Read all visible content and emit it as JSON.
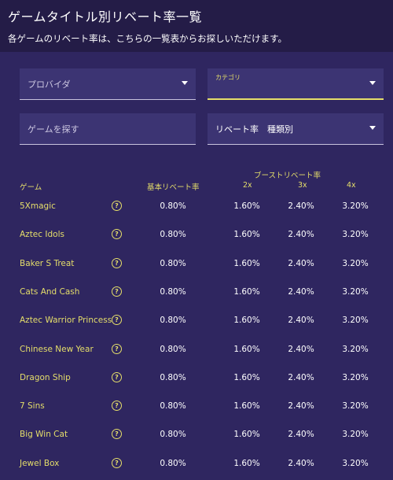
{
  "header": {
    "title": "ゲームタイトル別リベート率一覧",
    "subtitle": "各ゲームのリベート率は、こちらの一覧表からお探しいただけます。"
  },
  "filters": {
    "provider_placeholder": "プロバイダ",
    "category_label": "カテゴリ",
    "category_value": "",
    "search_placeholder": "ゲームを探す",
    "rebate_type": "リベート率　種類別"
  },
  "table": {
    "boost_header": "ブーストリベート率",
    "columns": {
      "game": "ゲーム",
      "base": "基本リベート率",
      "x2": "2x",
      "x3": "3x",
      "x4": "4x"
    },
    "help_glyph": "?",
    "rows": [
      {
        "name": "5Xmagic",
        "base": "0.80%",
        "x2": "1.60%",
        "x3": "2.40%",
        "x4": "3.20%"
      },
      {
        "name": "Aztec Idols",
        "base": "0.80%",
        "x2": "1.60%",
        "x3": "2.40%",
        "x4": "3.20%"
      },
      {
        "name": "Baker S Treat",
        "base": "0.80%",
        "x2": "1.60%",
        "x3": "2.40%",
        "x4": "3.20%"
      },
      {
        "name": "Cats And Cash",
        "base": "0.80%",
        "x2": "1.60%",
        "x3": "2.40%",
        "x4": "3.20%"
      },
      {
        "name": "Aztec Warrior Princess",
        "base": "0.80%",
        "x2": "1.60%",
        "x3": "2.40%",
        "x4": "3.20%"
      },
      {
        "name": "Chinese New Year",
        "base": "0.80%",
        "x2": "1.60%",
        "x3": "2.40%",
        "x4": "3.20%"
      },
      {
        "name": "Dragon Ship",
        "base": "0.80%",
        "x2": "1.60%",
        "x3": "2.40%",
        "x4": "3.20%"
      },
      {
        "name": "7 Sins",
        "base": "0.80%",
        "x2": "1.60%",
        "x3": "2.40%",
        "x4": "3.20%"
      },
      {
        "name": "Big Win Cat",
        "base": "0.80%",
        "x2": "1.60%",
        "x3": "2.40%",
        "x4": "3.20%"
      },
      {
        "name": "Jewel Box",
        "base": "0.80%",
        "x2": "1.60%",
        "x3": "2.40%",
        "x4": "3.20%"
      }
    ]
  },
  "colors": {
    "background": "#2a2152",
    "panel": "#2f2660",
    "accent": "#e5de6a"
  }
}
